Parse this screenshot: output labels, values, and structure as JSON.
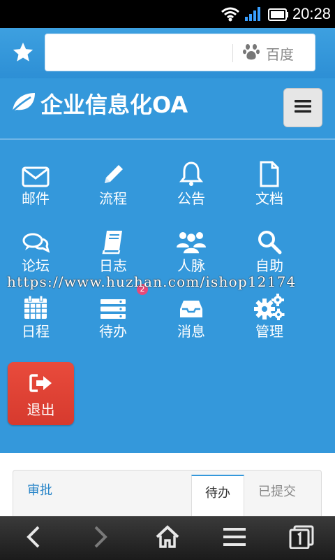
{
  "status_bar": {
    "time": "20:28"
  },
  "browser": {
    "url_value": "",
    "search_engine": "百度"
  },
  "header": {
    "title": "企业信息化OA"
  },
  "grid": {
    "items": [
      {
        "label": "邮件",
        "icon": "mail-icon"
      },
      {
        "label": "流程",
        "icon": "pencil-icon"
      },
      {
        "label": "公告",
        "icon": "bell-icon"
      },
      {
        "label": "文档",
        "icon": "document-icon"
      },
      {
        "label": "论坛",
        "icon": "chat-icon"
      },
      {
        "label": "日志",
        "icon": "book-icon"
      },
      {
        "label": "人脉",
        "icon": "users-icon"
      },
      {
        "label": "自助",
        "icon": "search-icon"
      },
      {
        "label": "日程",
        "icon": "calendar-icon"
      },
      {
        "label": "待办",
        "icon": "list-icon",
        "badge": "2"
      },
      {
        "label": "消息",
        "icon": "inbox-icon"
      },
      {
        "label": "管理",
        "icon": "gears-icon"
      }
    ],
    "logout_label": "退出"
  },
  "watermark": "https://www.huzhan.com/ishop12174",
  "approval": {
    "title": "审批",
    "tabs": [
      {
        "label": "待办",
        "active": true
      },
      {
        "label": "已提交",
        "active": false
      }
    ]
  },
  "colors": {
    "primary": "#3498db",
    "logout": "#e0443a",
    "badge": "#e84a7a"
  }
}
